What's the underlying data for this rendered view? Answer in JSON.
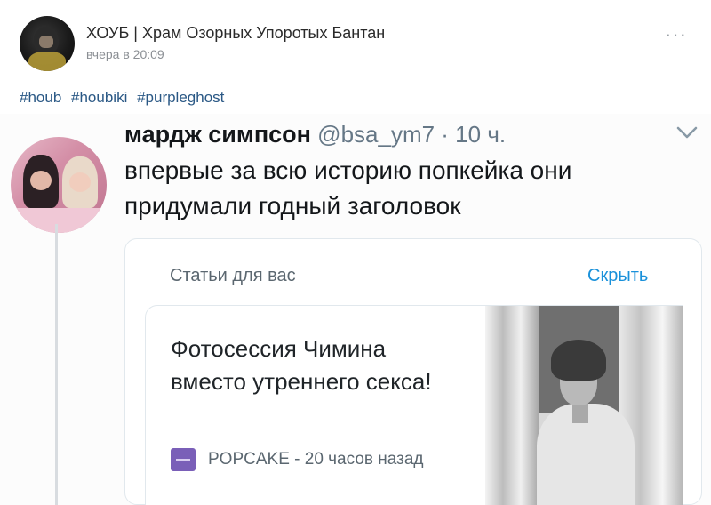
{
  "post": {
    "author": "ХОУБ | Храм Озорных Упоротых Бантан",
    "time": "вчера в 20:09",
    "more": "···",
    "hashtags": [
      "#houb",
      "#houbiki",
      "#purpleghost"
    ]
  },
  "tweet": {
    "display_name": "мардж симпсон",
    "meta": " @bsa_ym7 · 10 ч.",
    "text": "впервые за всю историю попкейка они придумали годный заголовок",
    "card": {
      "header": "Статьи для вас",
      "hide": "Скрыть",
      "article_title": "Фотосессия Чимина вместо утреннего секса!",
      "source": "POPCAKE - 20 часов назад"
    }
  },
  "colors": {
    "link": "#2a5885",
    "twitter_blue": "#1a91da",
    "popcake_purple": "#7a5fb8"
  },
  "icons": [
    "more-dots-icon",
    "chevron-down-icon",
    "popcake-logo-icon"
  ]
}
